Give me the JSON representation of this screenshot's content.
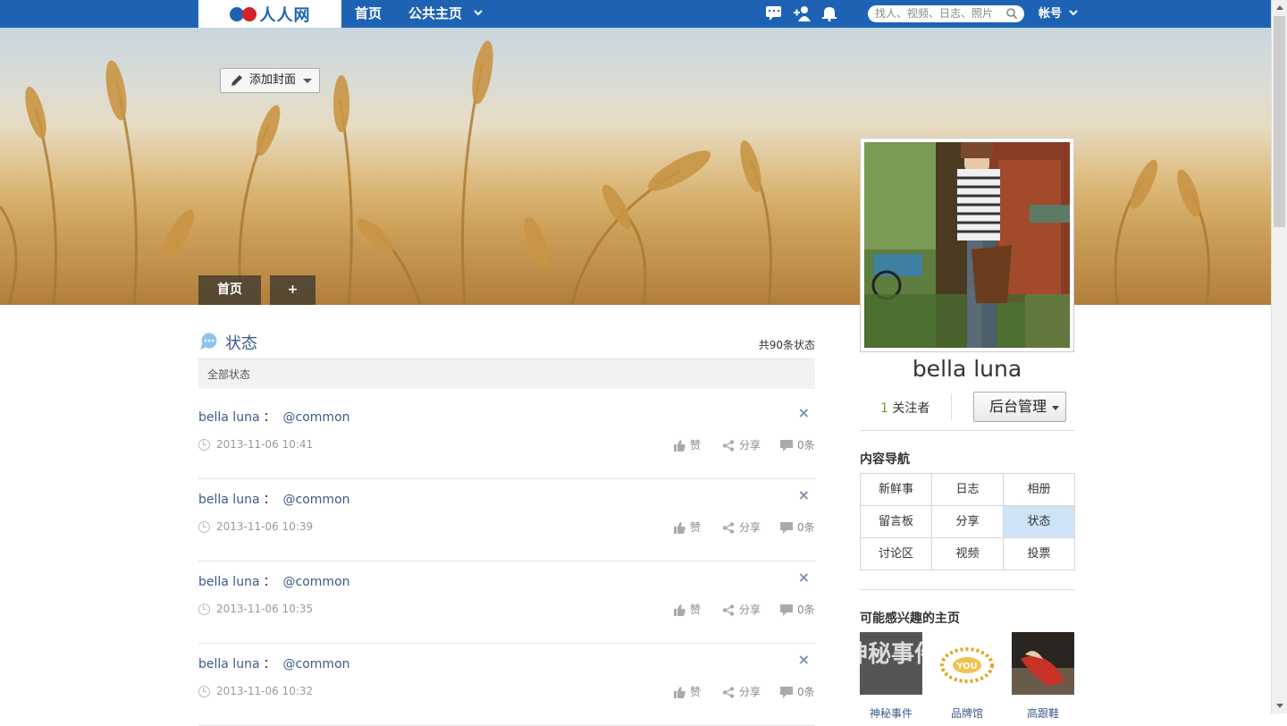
{
  "topbar": {
    "logo_text": "人人网",
    "nav": [
      "首页",
      "公共主页"
    ],
    "search_placeholder": "找人、视频、日志、照片",
    "account_label": "帐号",
    "icons": [
      "chat-icon",
      "add-friend-icon",
      "bell-icon"
    ]
  },
  "cover": {
    "add_cover_label": "添加封面",
    "tabs": [
      "首页",
      "+"
    ]
  },
  "status": {
    "title": "状态",
    "count_label": "共90条状态",
    "filter_label": "全部状态",
    "items": [
      {
        "author": "bella luna",
        "colon": "：",
        "mention": "@common",
        "time": "2013-11-06 10:41",
        "like": "赞",
        "share": "分享",
        "comments": "0条"
      },
      {
        "author": "bella luna",
        "colon": "：",
        "mention": "@common",
        "time": "2013-11-06 10:39",
        "like": "赞",
        "share": "分享",
        "comments": "0条"
      },
      {
        "author": "bella luna",
        "colon": "：",
        "mention": "@common",
        "time": "2013-11-06 10:35",
        "like": "赞",
        "share": "分享",
        "comments": "0条"
      },
      {
        "author": "bella luna",
        "colon": "：",
        "mention": "@common",
        "time": "2013-11-06 10:32",
        "like": "赞",
        "share": "分享",
        "comments": "0条"
      }
    ]
  },
  "profile": {
    "name": "bella luna",
    "follower_count": "1",
    "follower_label": "关注者",
    "admin_label": "后台管理"
  },
  "content_nav": {
    "title": "内容导航",
    "cells": [
      "新鲜事",
      "日志",
      "相册",
      "留言板",
      "分享",
      "状态",
      "讨论区",
      "视频",
      "投票"
    ],
    "active": "状态"
  },
  "recommend": {
    "title": "可能感兴趣的主页",
    "items": [
      {
        "label": "神秘事件",
        "thumb_text": "神秘事件"
      },
      {
        "label": "品牌馆",
        "thumb_text": "YOU"
      },
      {
        "label": "高跟鞋"
      }
    ]
  },
  "colors": {
    "brand_blue": "#1e63b3",
    "link_blue": "#3b5a8a",
    "active_cell": "#cfe3f6"
  }
}
